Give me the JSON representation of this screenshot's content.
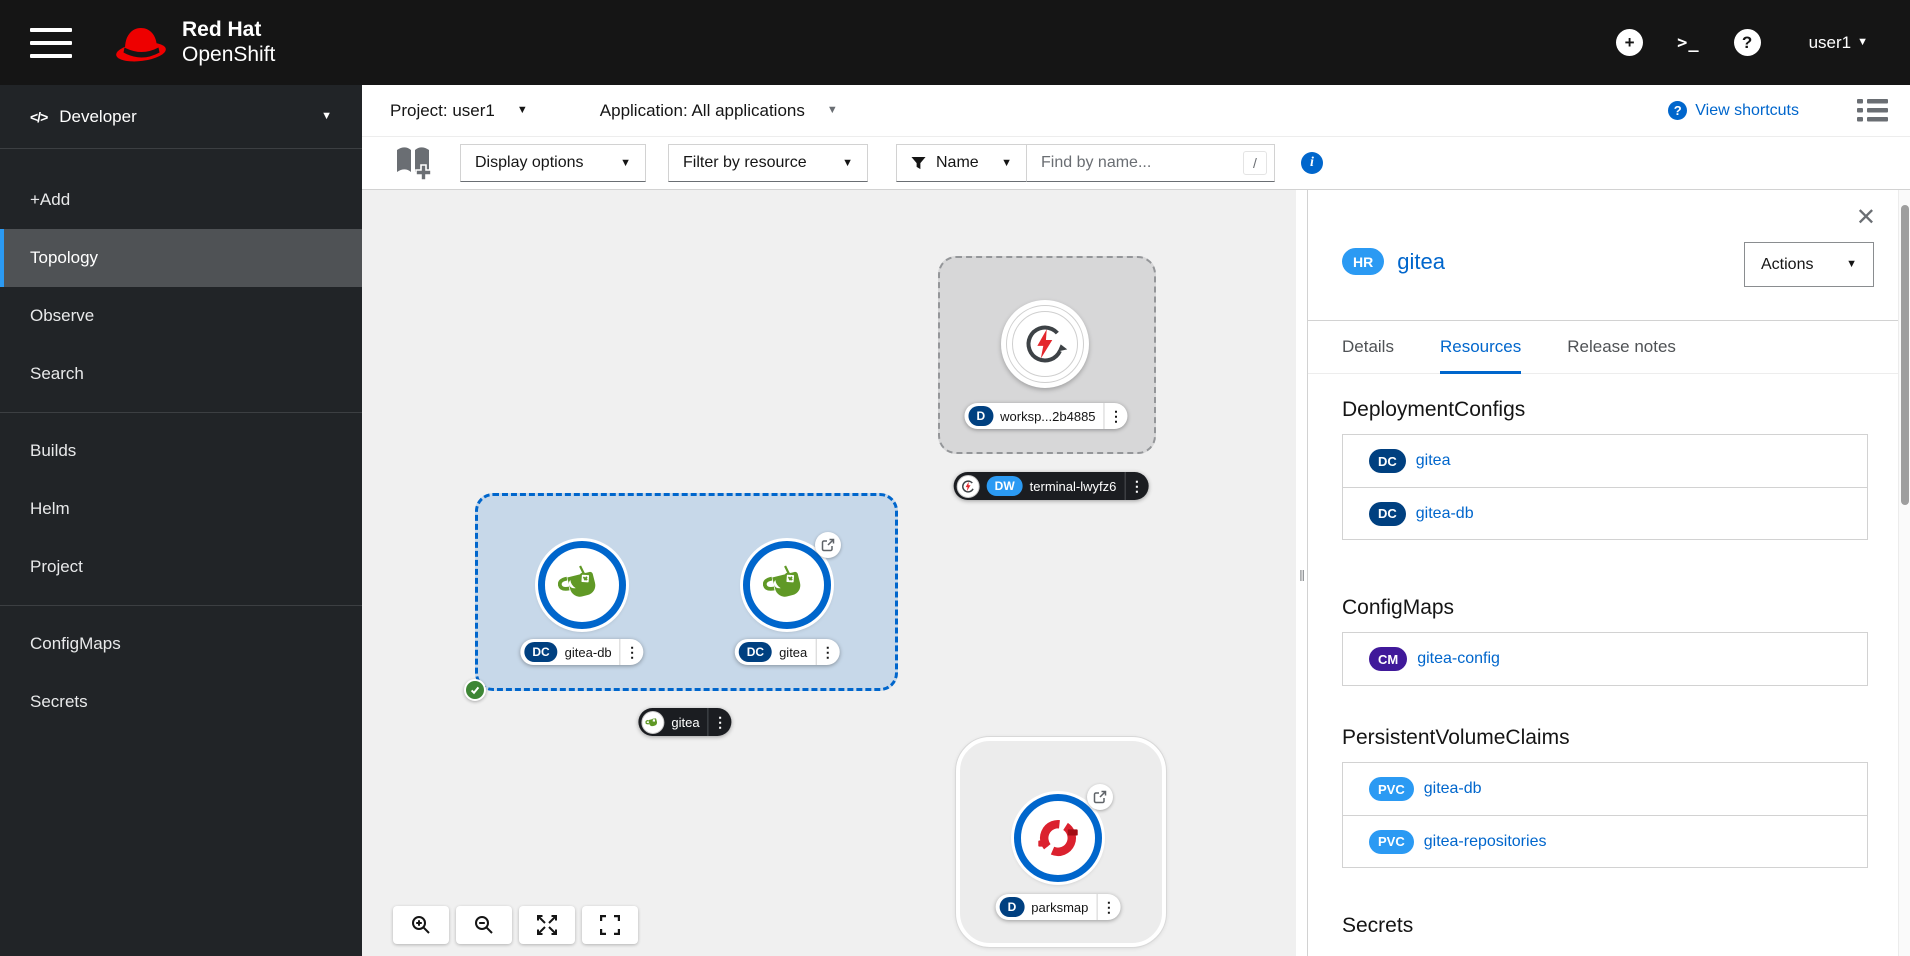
{
  "masthead": {
    "brand_line1": "Red Hat",
    "brand_line2": "OpenShift",
    "terminal_glyph": ">_",
    "plus_glyph": "+",
    "help_glyph": "?",
    "user": "user1"
  },
  "sidebar": {
    "perspective": "Developer",
    "items": [
      "+Add",
      "Topology",
      "Observe",
      "Search",
      "Builds",
      "Helm",
      "Project",
      "ConfigMaps",
      "Secrets"
    ],
    "active_item": "Topology"
  },
  "context_bar": {
    "project": "Project: user1",
    "application": "Application: All applications",
    "view_shortcuts": "View shortcuts",
    "shortcuts_help_glyph": "?"
  },
  "filter_bar": {
    "display_options": "Display options",
    "filter_by_resource": "Filter by resource",
    "name_filter": "Name",
    "find_placeholder": "Find by name...",
    "shortcut_hint": "/",
    "info_glyph": "i"
  },
  "topology": {
    "workspace_node": {
      "badge": "D",
      "name": "worksp...2b4885"
    },
    "terminal_label": {
      "badge": "DW",
      "name": "terminal-lwyfz6"
    },
    "gitea_db_node": {
      "badge": "DC",
      "name": "gitea-db"
    },
    "gitea_node": {
      "badge": "DC",
      "name": "gitea"
    },
    "gitea_app_label": {
      "name": "gitea"
    },
    "parksmap_node": {
      "badge": "D",
      "name": "parksmap"
    },
    "kebab_glyph": "⋮",
    "grip_glyph": "‖"
  },
  "side_panel": {
    "badge": "HR",
    "title": "gitea",
    "actions": "Actions",
    "close_glyph": "✕",
    "tabs": [
      "Details",
      "Resources",
      "Release notes"
    ],
    "active_tab": "Resources",
    "sections": [
      {
        "heading": "DeploymentConfigs",
        "items": [
          {
            "badge": "DC",
            "name": "gitea"
          },
          {
            "badge": "DC",
            "name": "gitea-db"
          }
        ]
      },
      {
        "heading": "ConfigMaps",
        "items": [
          {
            "badge": "CM",
            "name": "gitea-config"
          }
        ]
      },
      {
        "heading": "PersistentVolumeClaims",
        "items": [
          {
            "badge": "PVC",
            "name": "gitea-db"
          },
          {
            "badge": "PVC",
            "name": "gitea-repositories"
          }
        ]
      },
      {
        "heading": "Secrets",
        "items": []
      }
    ]
  },
  "colors": {
    "accent": "#0066cc",
    "masthead_bg": "#151515",
    "sidebar_bg": "#212427",
    "nav_active_bg": "#4f5255",
    "nav_active_bar": "#2b9af3",
    "dc_badge": "#004080",
    "cm_badge": "#40199a",
    "pvc_badge": "#2b9af3",
    "hr_badge": "#2b9af3",
    "dw_badge": "#2b9af3",
    "success_green": "#3e8635",
    "brand_red": "#ee0000",
    "gitea_green": "#609926",
    "openshift_red": "#db212e",
    "canvas_bg": "#f0f0f0"
  }
}
